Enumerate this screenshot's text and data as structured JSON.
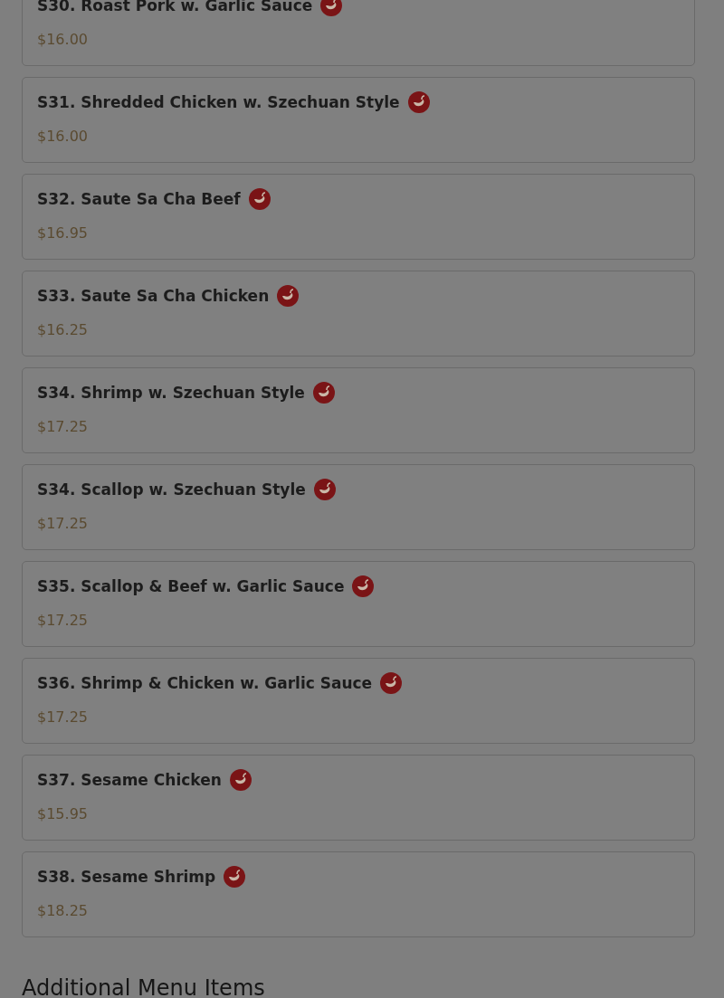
{
  "menu_items": [
    {
      "name": "S30. Roast Pork w. Garlic Sauce",
      "price": "$16.00",
      "spicy": true
    },
    {
      "name": "S31. Shredded Chicken w. Szechuan Style",
      "price": "$16.00",
      "spicy": true
    },
    {
      "name": "S32. Saute Sa Cha Beef",
      "price": "$16.95",
      "spicy": true
    },
    {
      "name": "S33. Saute Sa Cha Chicken",
      "price": "$16.25",
      "spicy": true
    },
    {
      "name": "S34. Shrimp w. Szechuan Style",
      "price": "$17.25",
      "spicy": true
    },
    {
      "name": "S34. Scallop w. Szechuan Style",
      "price": "$17.25",
      "spicy": true
    },
    {
      "name": "S35. Scallop & Beef w. Garlic Sauce",
      "price": "$17.25",
      "spicy": true
    },
    {
      "name": "S36. Shrimp & Chicken w. Garlic Sauce",
      "price": "$17.25",
      "spicy": true
    },
    {
      "name": "S37. Sesame Chicken",
      "price": "$15.95",
      "spicy": true
    },
    {
      "name": "S38. Sesame Shrimp",
      "price": "$18.25",
      "spicy": true
    }
  ],
  "section_heading": "Additional Menu Items"
}
